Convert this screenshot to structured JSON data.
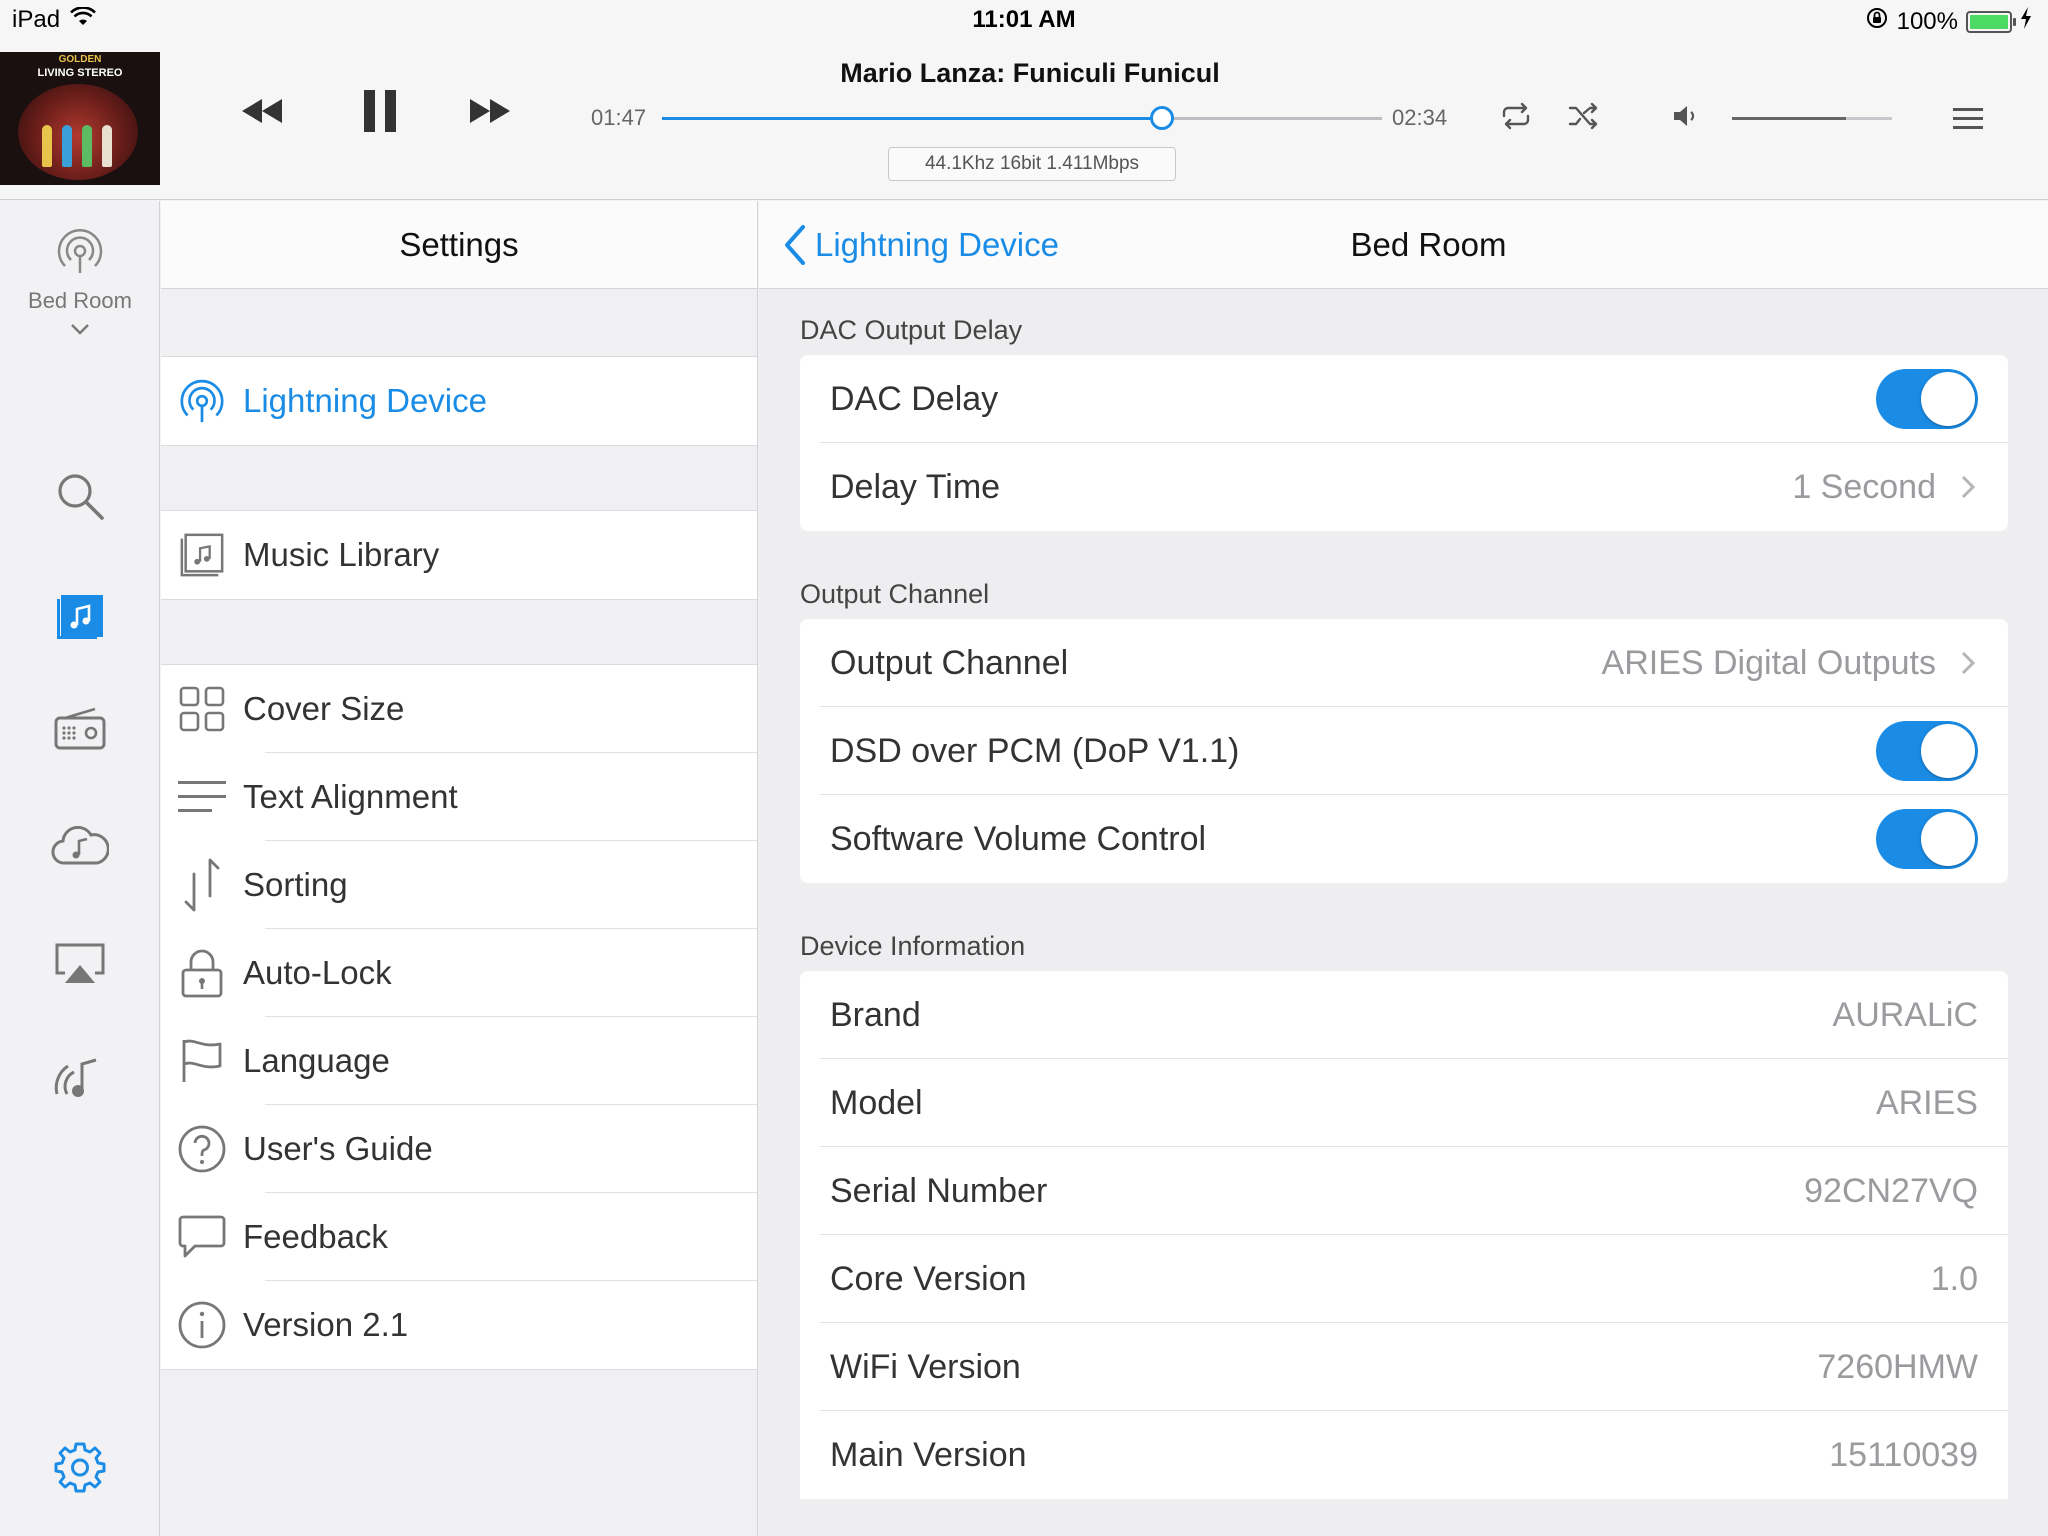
{
  "status_bar": {
    "device": "iPad",
    "time": "11:01 AM",
    "battery": "100%"
  },
  "player": {
    "album_art_text_top": "GOLDEN",
    "album_art_text_main": "LIVING STEREO",
    "track_title": "Mario Lanza: Funiculi Funicul",
    "elapsed": "01:47",
    "duration": "02:34",
    "progress_fraction": 0.695,
    "volume_fraction": 0.71,
    "format": "44.1Khz  16bit  1.411Mbps",
    "accent_color": "#1a8ce6",
    "icons": [
      "rewind-icon",
      "pause-icon",
      "fast-forward-icon",
      "repeat-icon",
      "shuffle-icon",
      "volume-icon",
      "menu-icon"
    ]
  },
  "rail": {
    "zone_label": "Bed Room",
    "icons": [
      "streaming-icon",
      "chevron-down-icon",
      "search-icon",
      "music-library-icon",
      "radio-icon",
      "cloud-music-icon",
      "airplay-icon",
      "wireless-music-icon",
      "gear-icon"
    ]
  },
  "settings": {
    "title": "Settings",
    "groups": [
      [
        {
          "label": "Lightning Device",
          "icon": "streaming-icon",
          "active": true
        }
      ],
      [
        {
          "label": "Music Library",
          "icon": "music-library-icon"
        }
      ],
      [
        {
          "label": "Cover Size",
          "icon": "grid-icon"
        },
        {
          "label": "Text Alignment",
          "icon": "text-align-icon"
        },
        {
          "label": "Sorting",
          "icon": "sort-icon"
        },
        {
          "label": "Auto-Lock",
          "icon": "lock-icon"
        },
        {
          "label": "Language",
          "icon": "flag-icon"
        },
        {
          "label": "User's Guide",
          "icon": "help-icon"
        },
        {
          "label": "Feedback",
          "icon": "chat-icon"
        },
        {
          "label": "Version 2.1",
          "icon": "info-icon"
        }
      ]
    ]
  },
  "detail": {
    "back_label": "Lightning Device",
    "title": "Bed Room",
    "sections": [
      {
        "label": "DAC Output Delay",
        "rows": [
          {
            "label": "DAC Delay",
            "toggle": true
          },
          {
            "label": "Delay Time",
            "value": "1 Second",
            "chevron": true
          }
        ]
      },
      {
        "label": "Output Channel",
        "rows": [
          {
            "label": "Output Channel",
            "value": "ARIES Digital Outputs",
            "chevron": true
          },
          {
            "label": "DSD over PCM (DoP V1.1)",
            "toggle": true
          },
          {
            "label": "Software Volume Control",
            "toggle": true
          }
        ]
      },
      {
        "label": "Device Information",
        "rows": [
          {
            "label": "Brand",
            "value": "AURALiC"
          },
          {
            "label": "Model",
            "value": "ARIES"
          },
          {
            "label": "Serial Number",
            "value": "92CN27VQ"
          },
          {
            "label": "Core Version",
            "value": "1.0"
          },
          {
            "label": "WiFi Version",
            "value": "7260HMW"
          },
          {
            "label": "Main Version",
            "value": "15110039"
          }
        ]
      }
    ]
  }
}
